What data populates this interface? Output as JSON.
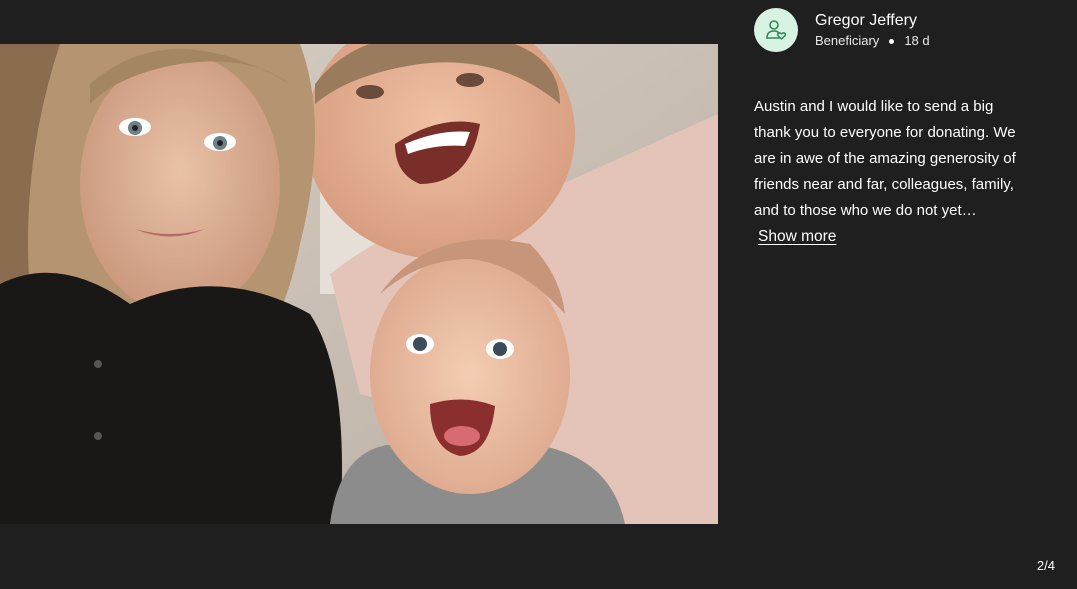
{
  "post": {
    "author_name": "Gregor Jeffery",
    "role": "Beneficiary",
    "age": "18 d",
    "text": "Austin and I would like to send a big thank you to everyone for donating. We are in awe of the amazing generosity of friends near and far, colleagues, family, and to those who we do not yet…",
    "show_more_label": "Show more"
  },
  "gallery": {
    "counter": "2/4"
  },
  "colors": {
    "background": "#1f1f1f",
    "avatar_bg": "#d9f3e3",
    "avatar_icon": "#2e8b57"
  },
  "icons": {
    "avatar": "user-heart-icon"
  }
}
